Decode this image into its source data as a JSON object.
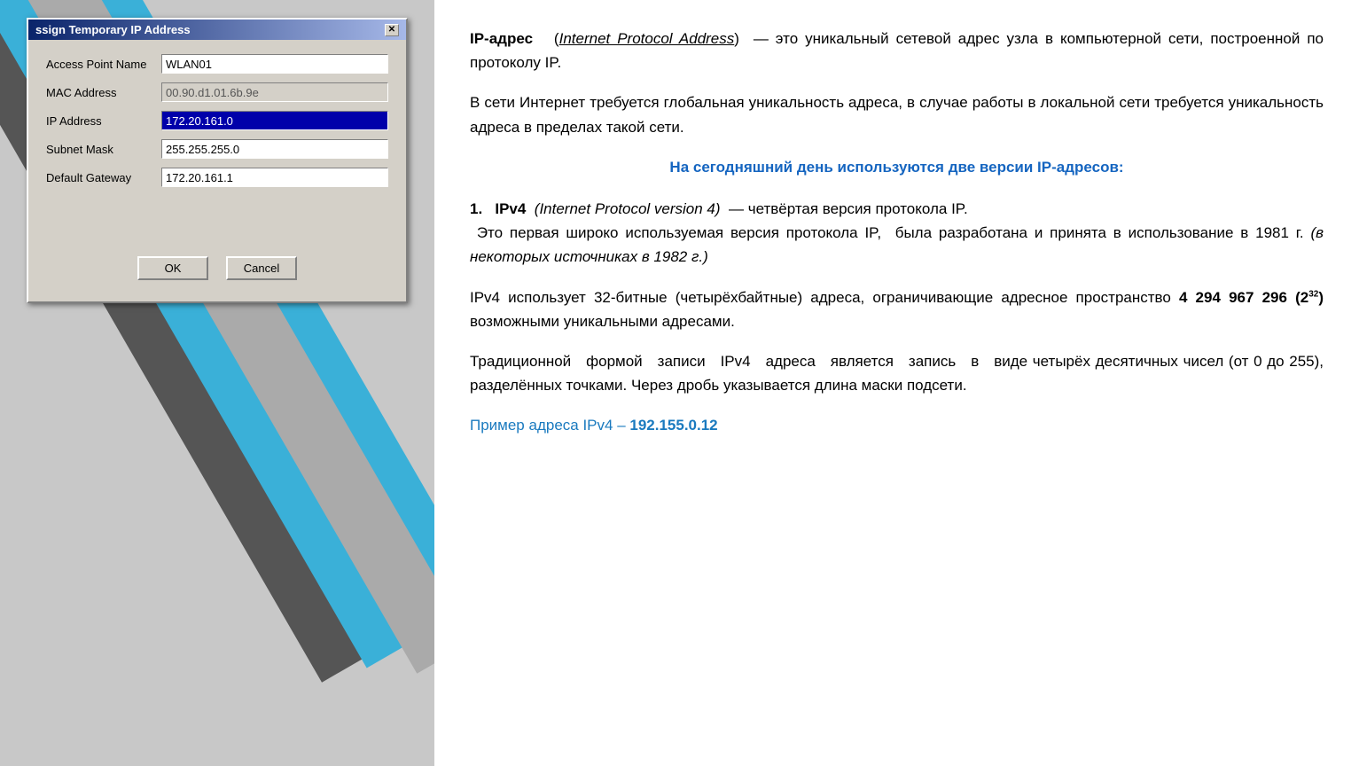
{
  "dialog": {
    "title": "ssign Temporary IP Address",
    "fields": [
      {
        "label": "Access Point Name",
        "value": "WLAN01",
        "type": "text"
      },
      {
        "label": "MAC Address",
        "value": "00.90.d1.01.6b.9e",
        "type": "readonly"
      },
      {
        "label": "IP Address",
        "value": "172.20.161.0",
        "type": "selected"
      },
      {
        "label": "Subnet Mask",
        "value": "255.255.255.0",
        "type": "text"
      },
      {
        "label": "Default Gateway",
        "value": "172.20.161.1",
        "type": "text"
      }
    ],
    "ok_label": "OK",
    "cancel_label": "Cancel"
  },
  "content": {
    "para1_pre": "IP-адрес",
    "para1_italic_underline": "(Internet Protocol Address)",
    "para1_rest": " — это уникальный сетевой адрес узла в компьютерной сети, построенной по протоколу IP.",
    "para2": "В сети Интернет требуется глобальная уникальность адреса, в случае работы в локальной сети требуется уникальность адреса в пределах такой сети.",
    "heading_blue": "На сегодняшний день используются две версии IP-адресов:",
    "section1_num": "1.",
    "section1_bold": "IPv4",
    "section1_italic": "(Internet Protocol version 4)",
    "section1_rest": " — четвёртая версия протокола IP.",
    "section1_para": "Это первая широко используемая версия протокола IP,  была разработана и принята в использование в 1981 г.",
    "section1_italic2": "(в некоторых источниках в 1982 г.)",
    "ipv4_para": "IPv4 использует 32-битные (четырёхбайтные) адреса, ограничивающие адресное пространство",
    "ipv4_bold": "4 294 967 296 (2",
    "ipv4_sup": "32",
    "ipv4_rest": ") возможными уникальными адресами.",
    "trad_para": "Традиционной формой записи IPv4 адреса является запись в виде четырёх десятичных чисел (от 0 до 255), разделённых точками. Через дробь указывается длина маски подсети.",
    "example_pre": "Пример адреса IPv4 –",
    "example_bold": "192.155.0.12"
  }
}
